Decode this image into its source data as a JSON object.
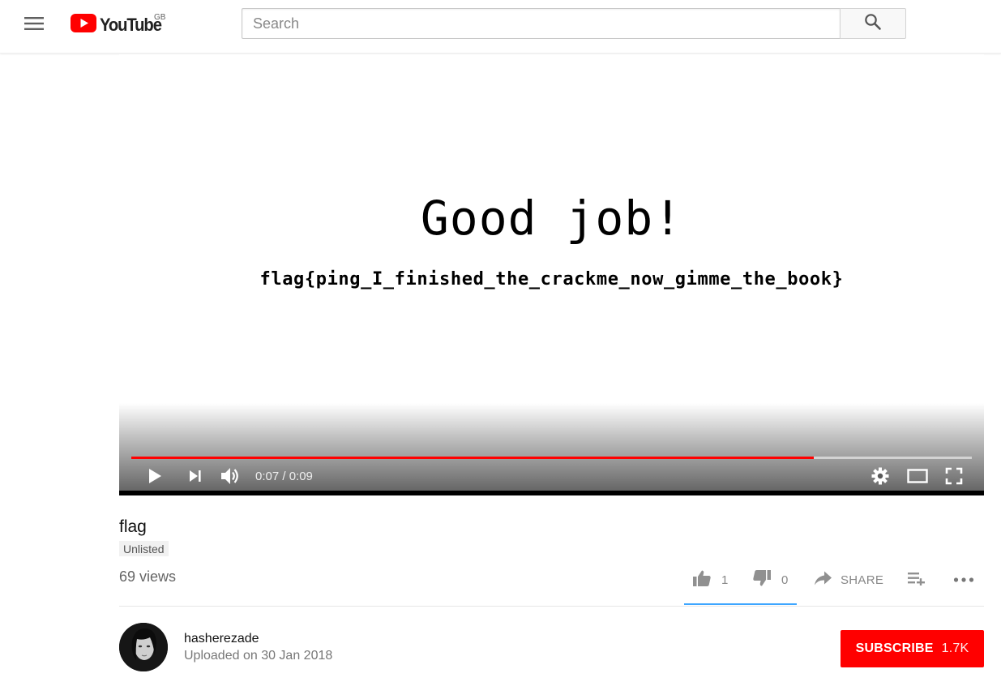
{
  "header": {
    "logo_text": "YouTube",
    "region": "GB",
    "search_placeholder": "Search",
    "icons": {
      "menu": "hamburger-icon",
      "search": "search-icon",
      "logo": "youtube-play-icon"
    },
    "brand_color": "#ff0000"
  },
  "video": {
    "frame_title": "Good job!",
    "frame_subtitle": "flag{ping_I_finished_the_crackme_now_gimme_the_book}",
    "current_time": "0:07",
    "duration": "0:09",
    "time_display": "0:07 / 0:09",
    "progress_fraction": 0.812,
    "progress_color": "#ff0000",
    "controls": {
      "play": "play-icon",
      "next": "next-icon",
      "volume": "volume-icon",
      "settings": "gear-icon",
      "theater": "theater-mode-icon",
      "fullscreen": "fullscreen-icon"
    }
  },
  "info": {
    "title": "flag",
    "badge": "Unlisted",
    "views": "69 views",
    "likes": "1",
    "dislikes": "0",
    "share_label": "SHARE",
    "like_fraction": 1.0,
    "icons": {
      "like": "thumbs-up-icon",
      "dislike": "thumbs-down-icon",
      "share": "share-arrow-icon",
      "save": "add-to-playlist-icon",
      "more": "more-horizontal-icon"
    }
  },
  "channel": {
    "name": "hasherezade",
    "upload_date": "Uploaded on 30 Jan 2018",
    "subscribe_label": "SUBSCRIBE",
    "subscriber_count": "1.7K"
  }
}
